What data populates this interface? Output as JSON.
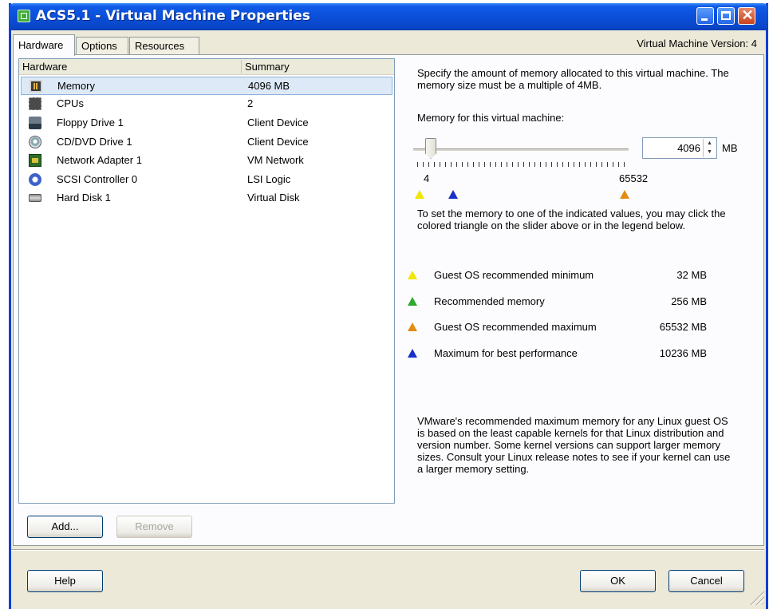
{
  "window": {
    "title": "ACS5.1 - Virtual Machine Properties",
    "controls": {
      "close_glyph": "✕"
    }
  },
  "tabs": [
    {
      "label": "Hardware",
      "active": true
    },
    {
      "label": "Options",
      "active": false
    },
    {
      "label": "Resources",
      "active": false
    }
  ],
  "vm_version": "Virtual Machine Version: 4",
  "hardware_list": {
    "columns": [
      "Hardware",
      "Summary"
    ],
    "rows": [
      {
        "icon": "memory-icon",
        "name": "Memory",
        "summary": "4096 MB",
        "selected": true
      },
      {
        "icon": "cpu-icon",
        "name": "CPUs",
        "summary": "2",
        "selected": false
      },
      {
        "icon": "floppy-icon",
        "name": "Floppy Drive 1",
        "summary": "Client Device",
        "selected": false
      },
      {
        "icon": "cd-dvd-icon",
        "name": "CD/DVD Drive 1",
        "summary": "Client Device",
        "selected": false
      },
      {
        "icon": "network-adapter-icon",
        "name": "Network Adapter 1",
        "summary": "VM Network",
        "selected": false
      },
      {
        "icon": "scsi-controller-icon",
        "name": "SCSI Controller 0",
        "summary": "LSI Logic",
        "selected": false
      },
      {
        "icon": "hard-disk-icon",
        "name": "Hard Disk 1",
        "summary": "Virtual Disk",
        "selected": false
      }
    ]
  },
  "buttons": {
    "add": "Add...",
    "remove": "Remove",
    "help": "Help",
    "ok": "OK",
    "cancel": "Cancel"
  },
  "memory_panel": {
    "description": "Specify the amount of memory allocated to this virtual machine. The memory size must be a multiple of 4MB.",
    "memory_label": "Memory for this virtual machine:",
    "value": "4096",
    "unit": "MB",
    "slider_min_label": "4",
    "slider_max_label": "65532",
    "hint": "To set the memory to one of the indicated values, you may click the colored triangle on the slider above or in the legend below.",
    "legend": [
      {
        "label": "Guest OS recommended minimum",
        "value": "32 MB",
        "color": "#f2e600"
      },
      {
        "label": "Recommended memory",
        "value": "256 MB",
        "color": "#2fa830"
      },
      {
        "label": "Guest OS recommended maximum",
        "value": "65532 MB",
        "color": "#e38b12"
      },
      {
        "label": "Maximum for best performance",
        "value": "10236 MB",
        "color": "#1630c8"
      }
    ],
    "note": "VMware's recommended maximum memory for any Linux guest OS is based on the least capable kernels for that Linux distribution and version number. Some kernel versions can support larger memory sizes. Consult your Linux release notes to see if your kernel can use a larger memory setting."
  }
}
